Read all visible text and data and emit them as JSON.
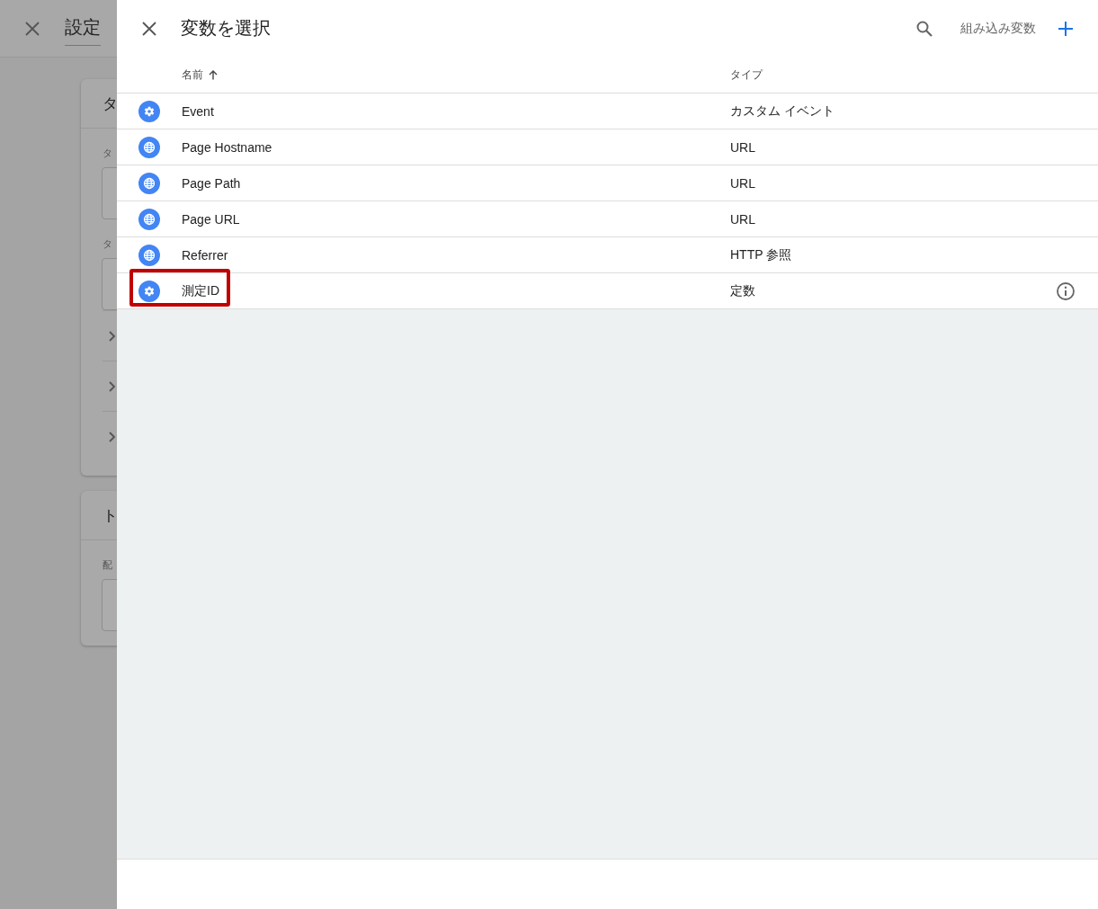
{
  "background": {
    "title": "設定",
    "cards": [
      {
        "heading": "タ",
        "fields": [
          {
            "label": "タ"
          },
          {
            "label": "タ"
          }
        ],
        "sections": [
          {
            "expanded": false
          },
          {
            "expanded": false
          },
          {
            "expanded": false
          }
        ]
      },
      {
        "heading": "ト",
        "fields": [
          {
            "label": "配"
          }
        ]
      }
    ]
  },
  "panel": {
    "title": "変数を選択",
    "builtin_button": "組み込み変数",
    "columns": [
      {
        "label": "名前",
        "sorted": true
      },
      {
        "label": "タイプ",
        "sorted": false
      }
    ],
    "rows": [
      {
        "name": "Event",
        "type": "カスタム イベント",
        "kind": "gear",
        "info": false,
        "highlighted": false
      },
      {
        "name": "Page Hostname",
        "type": "URL",
        "kind": "globe",
        "info": false,
        "highlighted": false
      },
      {
        "name": "Page Path",
        "type": "URL",
        "kind": "globe",
        "info": false,
        "highlighted": false
      },
      {
        "name": "Page URL",
        "type": "URL",
        "kind": "globe",
        "info": false,
        "highlighted": false
      },
      {
        "name": "Referrer",
        "type": "HTTP 参照",
        "kind": "globe",
        "info": false,
        "highlighted": false
      },
      {
        "name": "測定ID",
        "type": "定数",
        "kind": "gear",
        "info": true,
        "highlighted": true
      }
    ]
  }
}
